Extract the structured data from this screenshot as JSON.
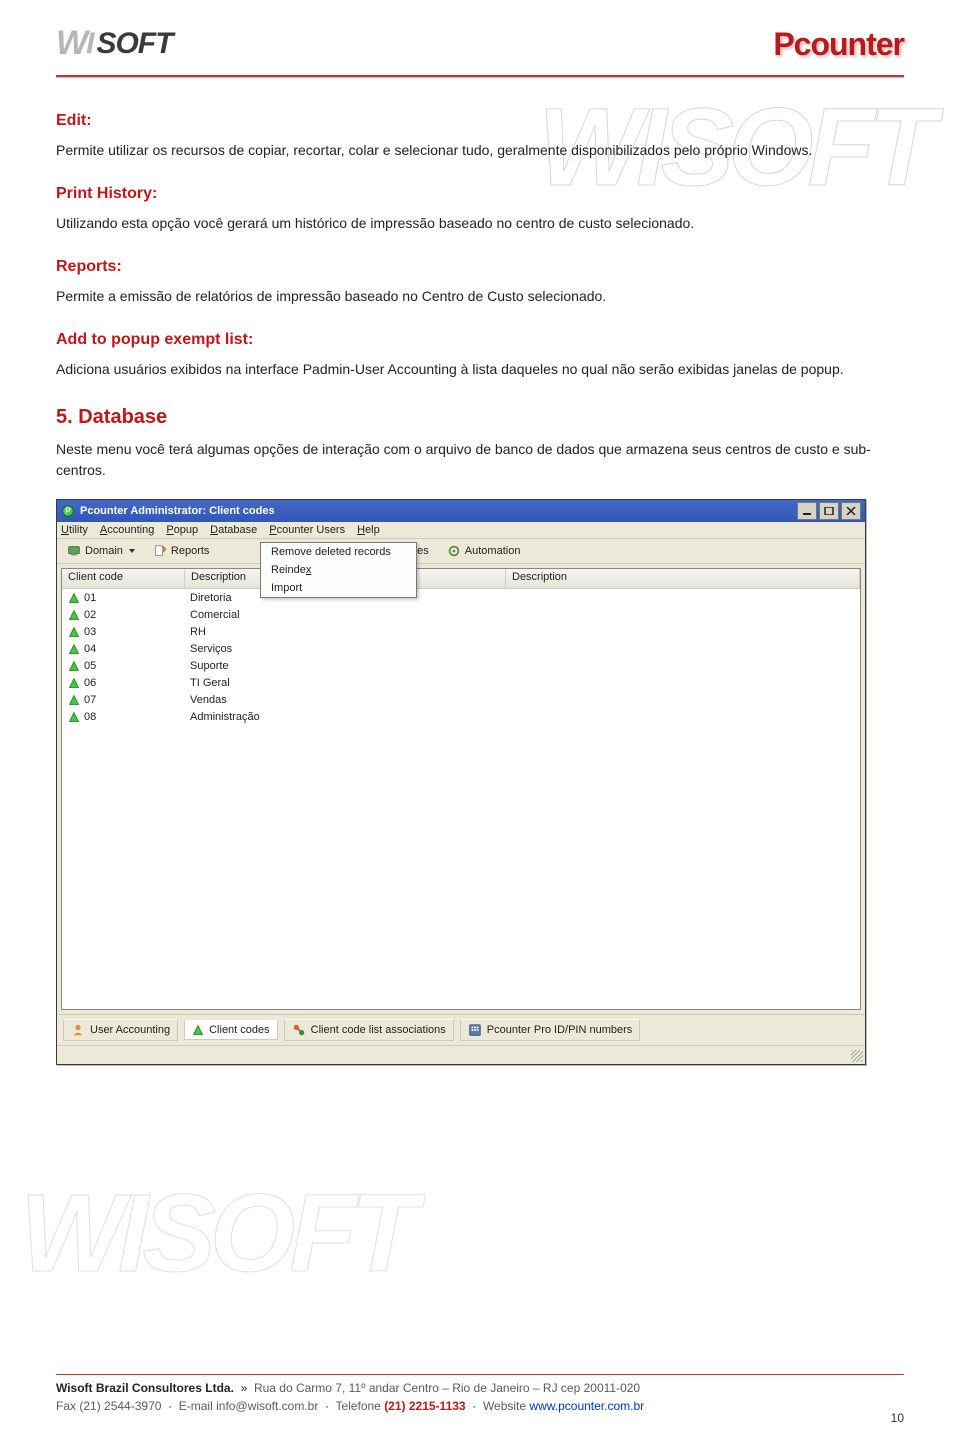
{
  "header": {
    "logo_left": "WISOFT",
    "logo_right": "Pcounter"
  },
  "sections": {
    "edit_heading": "Edit:",
    "edit_body": "Permite utilizar os recursos de copiar, recortar, colar e selecionar tudo, geralmente disponibilizados pelo próprio Windows.",
    "printhist_heading": "Print History:",
    "printhist_body": "Utilizando esta opção você gerará um histórico de impressão baseado no centro de custo selecionado.",
    "reports_heading": "Reports:",
    "reports_body": "Permite a emissão de relatórios de impressão baseado no Centro de Custo selecionado.",
    "add_heading": "Add to popup exempt list:",
    "add_body": "Adiciona usuários exibidos na interface Padmin-User Accounting à lista daqueles no qual não serão exibidas janelas de popup.",
    "database_title": "5. Database",
    "database_body": "Neste menu você terá algumas opções de interação com o arquivo de banco de dados que armazena seus centros de custo e sub-centros."
  },
  "screenshot": {
    "window_title": "Pcounter Administrator: Client codes",
    "menu": {
      "utility": {
        "u": "U",
        "rest": "tility"
      },
      "accounting": {
        "u": "A",
        "rest": "ccounting"
      },
      "popup": {
        "u": "P",
        "rest": "opup"
      },
      "database": {
        "u": "D",
        "rest": "atabase"
      },
      "pusers": {
        "u": "P",
        "rest": "counter Users"
      },
      "help": {
        "u": "H",
        "rest": "elp"
      }
    },
    "db_dropdown": {
      "remove": "Remove deleted records",
      "reindex_u": "x",
      "reindex_pre": "Reinde",
      "import": "Import"
    },
    "toolbar": {
      "domain": "Domain",
      "reports": "Reports",
      "ences_frag": "ences",
      "automation": "Automation"
    },
    "col_clientcode": "Client code",
    "col_description": "Description",
    "rows": [
      {
        "code": "01",
        "desc": "Diretoria"
      },
      {
        "code": "02",
        "desc": "Comercial"
      },
      {
        "code": "03",
        "desc": "RH"
      },
      {
        "code": "04",
        "desc": "Serviços"
      },
      {
        "code": "05",
        "desc": "Suporte"
      },
      {
        "code": "06",
        "desc": "TI Geral"
      },
      {
        "code": "07",
        "desc": "Vendas"
      },
      {
        "code": "08",
        "desc": "Administração"
      }
    ],
    "bottom_tabs": {
      "user_accounting": "User Accounting",
      "client_codes": "Client codes",
      "associations": "Client code list associations",
      "idpin": "Pcounter Pro ID/PIN numbers"
    }
  },
  "footer": {
    "company": "Wisoft Brazil Consultores Ltda.",
    "arrow": "»",
    "address": "Rua do Carmo 7, 11º andar  Centro – Rio de Janeiro – RJ  cep 20011-020",
    "fax_label": "Fax",
    "fax": "(21) 2544-3970",
    "sep": "·",
    "email_label": "E-mail",
    "email": "info@wisoft.com.br",
    "tel_label": "Telefone",
    "tel": "(21) 2215-1133",
    "web_label": "Website",
    "web": "www.pcounter.com.br"
  },
  "page_number": "10",
  "watermark": "WISOFT"
}
